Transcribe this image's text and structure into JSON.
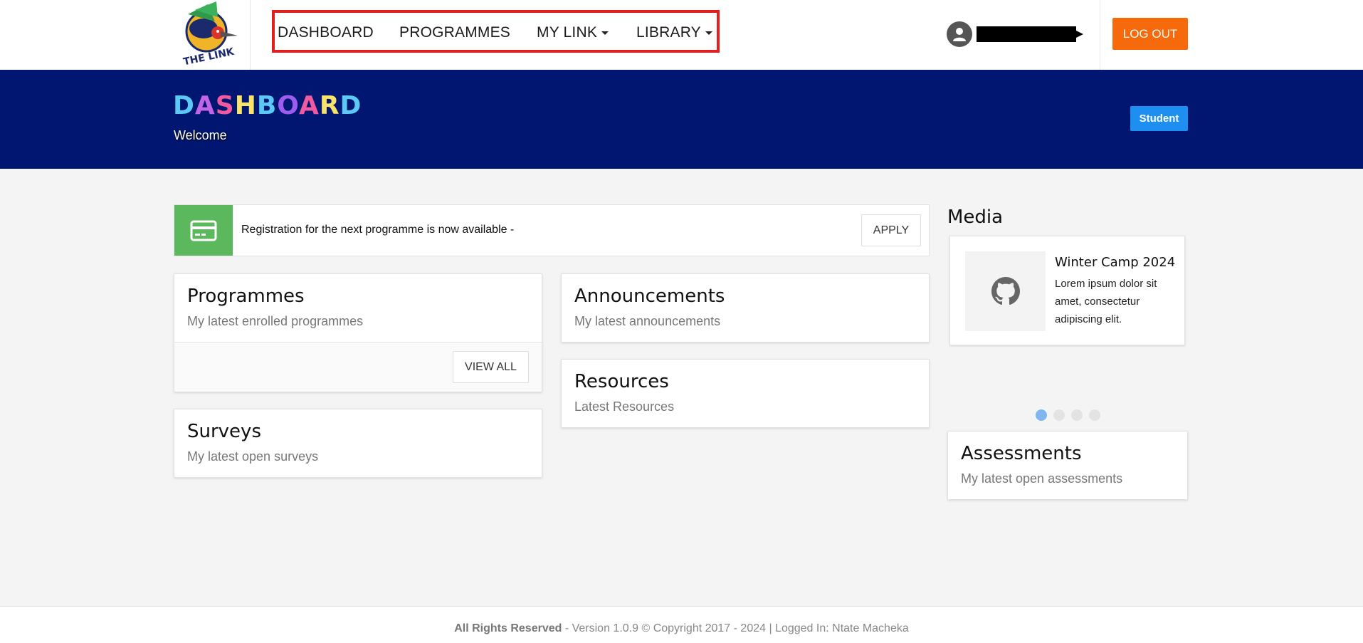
{
  "nav": {
    "items": [
      {
        "label": "DASHBOARD",
        "dropdown": false
      },
      {
        "label": "PROGRAMMES",
        "dropdown": false
      },
      {
        "label": "MY LINK",
        "dropdown": true
      },
      {
        "label": "LIBRARY",
        "dropdown": true
      }
    ],
    "logout_label": "LOG OUT",
    "highlight_color": "#e02020"
  },
  "logo": {
    "text": "THE LINK"
  },
  "banner": {
    "title_letters": [
      {
        "ch": "D",
        "color": "#5bc8f5"
      },
      {
        "ch": "A",
        "color": "#c264e6"
      },
      {
        "ch": "S",
        "color": "#ef5aa0"
      },
      {
        "ch": "H",
        "color": "#f9e36b"
      },
      {
        "ch": "B",
        "color": "#5bc8f5"
      },
      {
        "ch": "O",
        "color": "#9d5cf0"
      },
      {
        "ch": "A",
        "color": "#ef5aa0"
      },
      {
        "ch": "R",
        "color": "#f9e36b"
      },
      {
        "ch": "D",
        "color": "#5bc8f5"
      }
    ],
    "subtitle": "Welcome",
    "role_badge": "Student",
    "background": "#001670"
  },
  "info_box": {
    "text": "Registration for the next programme is now available -",
    "apply_label": "APPLY",
    "icon": "credit-card-icon"
  },
  "cards": {
    "programmes": {
      "title": "Programmes",
      "subtitle": "My latest enrolled programmes",
      "button": "VIEW ALL"
    },
    "surveys": {
      "title": "Surveys",
      "subtitle": "My latest open surveys"
    },
    "announcements": {
      "title": "Announcements",
      "subtitle": "My latest announcements"
    },
    "resources": {
      "title": "Resources",
      "subtitle": "Latest Resources"
    },
    "assessments": {
      "title": "Assessments",
      "subtitle": "My latest open assessments"
    }
  },
  "media": {
    "heading": "Media",
    "item_title": "Winter Camp 2024",
    "item_text": "Lorem ipsum dolor sit amet, consectetur adipiscing elit.",
    "thumb_icon": "github-icon",
    "dot_count": 4,
    "active_dot": 1
  },
  "footer": {
    "bold": "All Rights Reserved",
    "rest": " - Version 1.0.9 © Copyright 2017 - 2024 | Logged In: Ntate Macheka"
  },
  "colors": {
    "logout": "#f76a0c",
    "badge": "#1e8ff0",
    "info_icon_bg": "#5cb85c"
  }
}
